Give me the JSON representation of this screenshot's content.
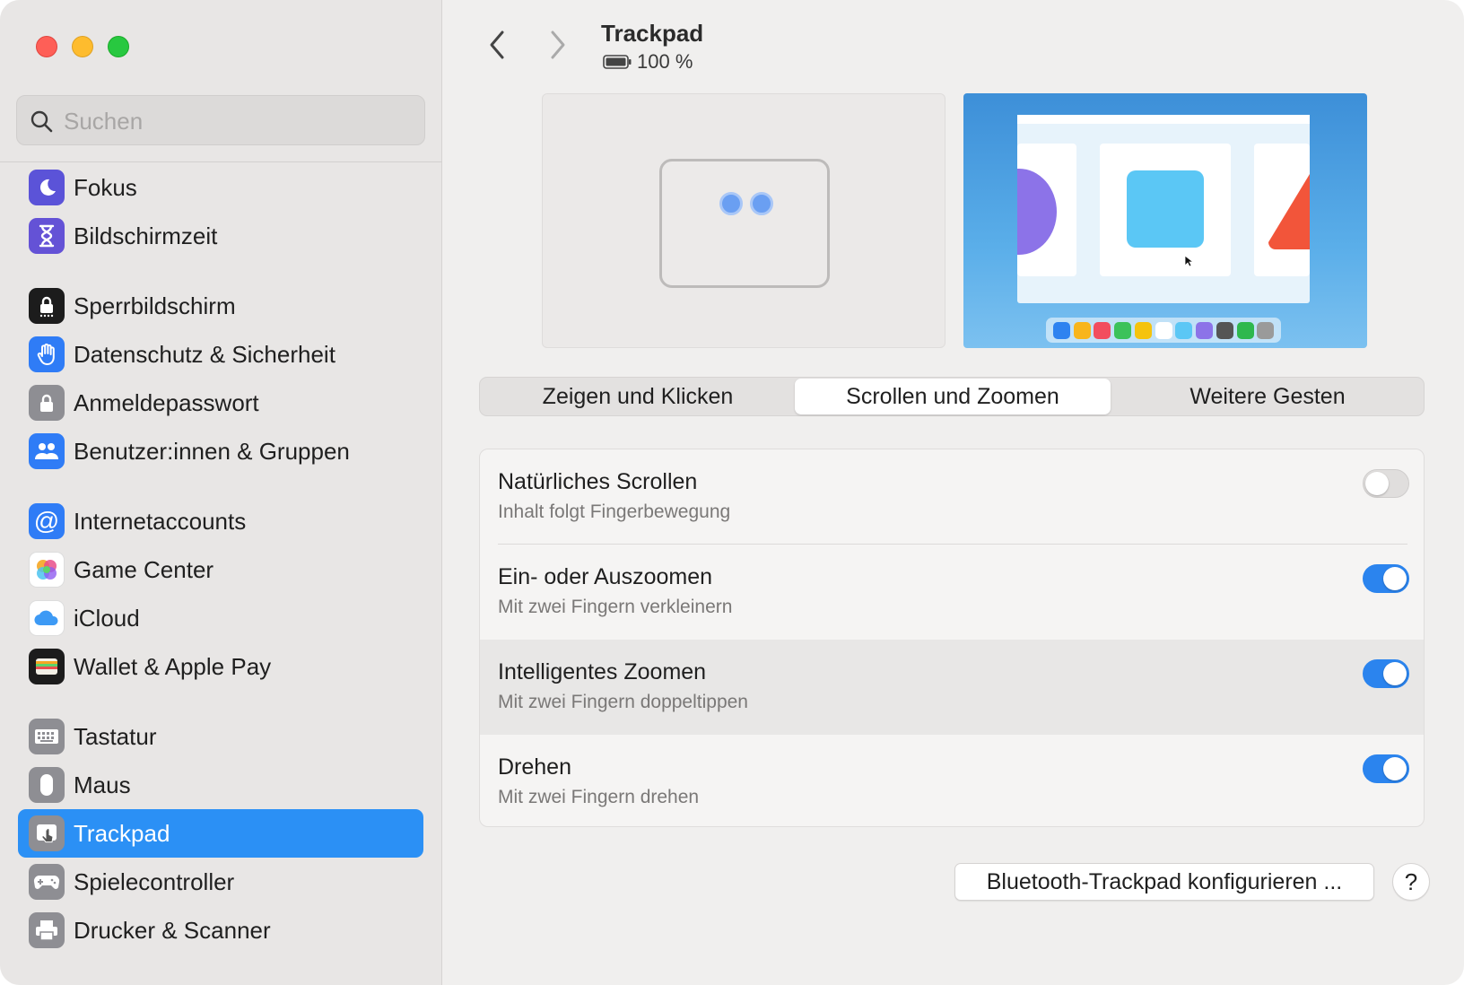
{
  "search": {
    "placeholder": "Suchen"
  },
  "sidebar": {
    "items": [
      {
        "label": "Fokus",
        "icon": "moon-icon",
        "color": "#5b53d8"
      },
      {
        "label": "Bildschirmzeit",
        "icon": "hourglass-icon",
        "color": "#6452d6"
      },
      {
        "label": "Sperrbildschirm",
        "icon": "lock-screen-icon",
        "color": "#1c1c1c"
      },
      {
        "label": "Datenschutz & Sicherheit",
        "icon": "hand-icon",
        "color": "#2f7cf6"
      },
      {
        "label": "Anmeldepasswort",
        "icon": "padlock-icon",
        "color": "#8e8e93"
      },
      {
        "label": "Benutzer:innen & Gruppen",
        "icon": "users-icon",
        "color": "#2f7cf6"
      },
      {
        "label": "Internetaccounts",
        "icon": "at-icon",
        "color": "#2f7cf6"
      },
      {
        "label": "Game Center",
        "icon": "game-center-icon",
        "color": "#ffffff"
      },
      {
        "label": "iCloud",
        "icon": "cloud-icon",
        "color": "#ffffff"
      },
      {
        "label": "Wallet & Apple Pay",
        "icon": "wallet-icon",
        "color": "#1c1c1c"
      },
      {
        "label": "Tastatur",
        "icon": "keyboard-icon",
        "color": "#8e8e93"
      },
      {
        "label": "Maus",
        "icon": "mouse-icon",
        "color": "#8e8e93"
      },
      {
        "label": "Trackpad",
        "icon": "trackpad-icon",
        "color": "#8e8e93",
        "selected": true
      },
      {
        "label": "Spielecontroller",
        "icon": "gamepad-icon",
        "color": "#8e8e93"
      },
      {
        "label": "Drucker & Scanner",
        "icon": "printer-icon",
        "color": "#8e8e93"
      }
    ]
  },
  "header": {
    "title": "Trackpad",
    "battery": "100 %"
  },
  "tabs": [
    {
      "label": "Zeigen und Klicken",
      "active": false
    },
    {
      "label": "Scrollen und Zoomen",
      "active": true
    },
    {
      "label": "Weitere Gesten",
      "active": false
    }
  ],
  "settings": [
    {
      "title": "Natürliches Scrollen",
      "subtitle": "Inhalt folgt Fingerbewegung",
      "enabled": false
    },
    {
      "title": "Ein- oder Auszoomen",
      "subtitle": "Mit zwei Fingern verkleinern",
      "enabled": true
    },
    {
      "title": "Intelligentes Zoomen",
      "subtitle": "Mit zwei Fingern doppeltippen",
      "enabled": true
    },
    {
      "title": "Drehen",
      "subtitle": "Mit zwei Fingern drehen",
      "enabled": true
    }
  ],
  "footer": {
    "bluetooth_label": "Bluetooth-Trackpad konfigurieren ...",
    "help_label": "?"
  },
  "colors": {
    "accent": "#2b90f5",
    "toggle_on": "#2b84ee"
  }
}
